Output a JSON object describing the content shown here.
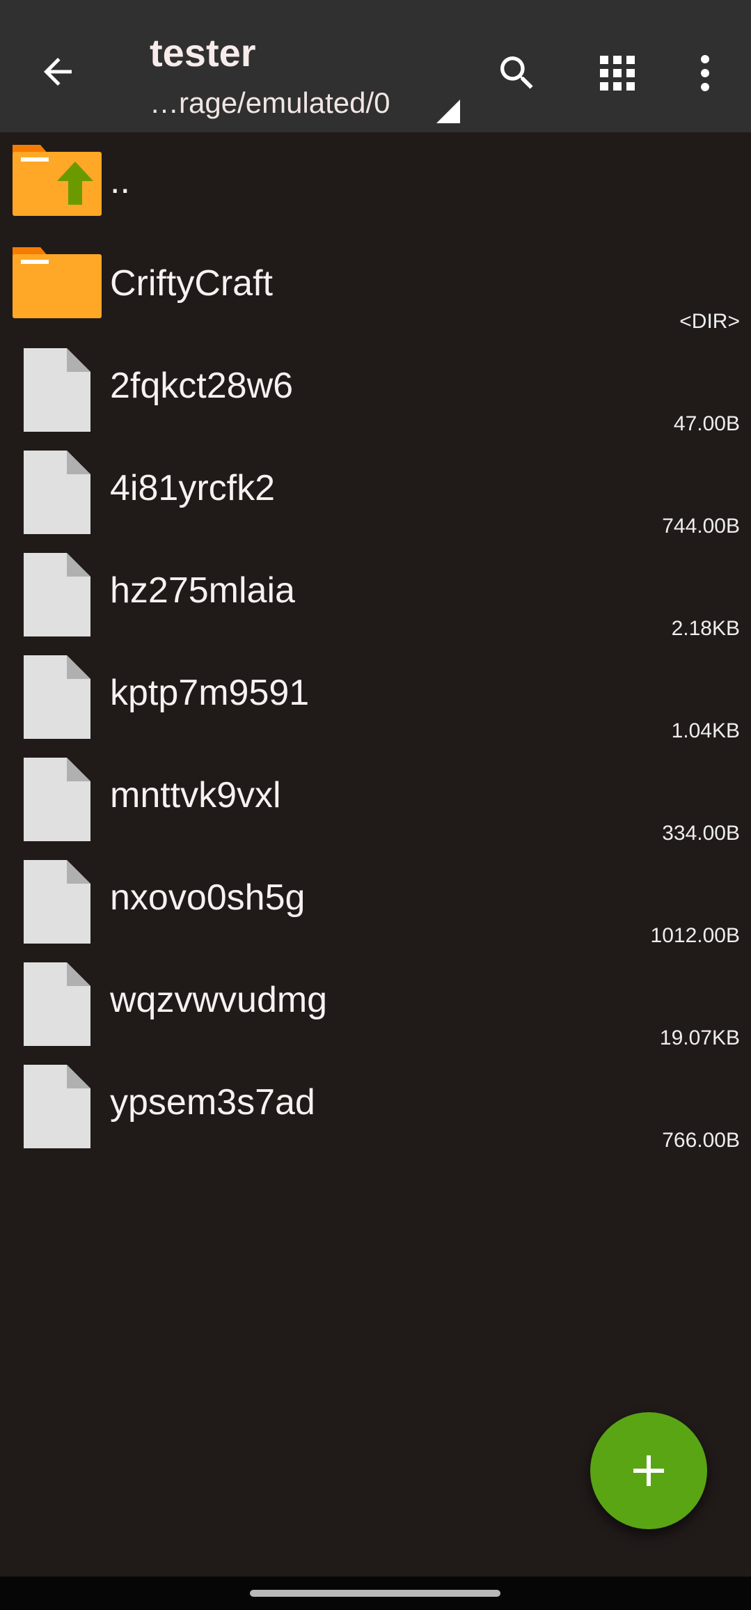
{
  "toolbar": {
    "title": "tester",
    "path": "…rage/emulated/0",
    "icons": {
      "back": "arrow-back-icon",
      "search": "search-icon",
      "grid": "grid-view-icon",
      "more": "more-vert-icon"
    }
  },
  "files": [
    {
      "name": "..",
      "size": "",
      "icon": "folder-up-icon",
      "type": "parent"
    },
    {
      "name": "CriftyCraft",
      "size": "<DIR>",
      "icon": "folder-icon",
      "type": "folder"
    },
    {
      "name": "2fqkct28w6",
      "size": "47.00B",
      "icon": "file-icon",
      "type": "file"
    },
    {
      "name": "4i81yrcfk2",
      "size": "744.00B",
      "icon": "file-icon",
      "type": "file"
    },
    {
      "name": "hz275mlaia",
      "size": "2.18KB",
      "icon": "file-icon",
      "type": "file"
    },
    {
      "name": "kptp7m9591",
      "size": "1.04KB",
      "icon": "file-icon",
      "type": "file"
    },
    {
      "name": "mnttvk9vxl",
      "size": "334.00B",
      "icon": "file-icon",
      "type": "file"
    },
    {
      "name": "nxovo0sh5g",
      "size": "1012.00B",
      "icon": "file-icon",
      "type": "file"
    },
    {
      "name": "wqzvwvudmg",
      "size": "19.07KB",
      "icon": "file-icon",
      "type": "file"
    },
    {
      "name": "ypsem3s7ad",
      "size": "766.00B",
      "icon": "file-icon",
      "type": "file"
    }
  ],
  "fab": {
    "icon": "plus-icon"
  },
  "colors": {
    "toolbar": "#303030",
    "background": "#201a19",
    "folder": "#ffa726",
    "folder_tab": "#f57c00",
    "up_arrow": "#6b9a00",
    "file": "#e0e0e0",
    "fab": "#5aa514"
  }
}
